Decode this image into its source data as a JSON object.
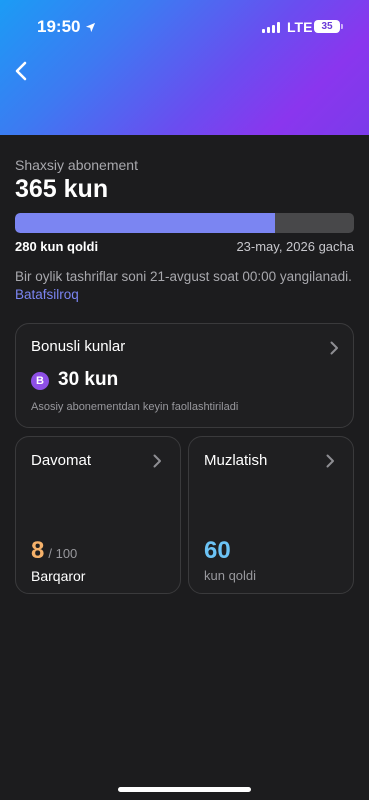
{
  "status_bar": {
    "time": "19:50",
    "network": "LTE",
    "battery": "35"
  },
  "subscription": {
    "label": "Shaxsiy abonement",
    "title": "365 kun",
    "progress_fraction": 0.767,
    "days_left": "280 kun qoldi",
    "until": "23-may, 2026 gacha",
    "info_text": "Bir oylik tashriflar soni 21-avgust soat 00:00 yangilanadi.",
    "info_link": "Batafsilroq"
  },
  "bonus_card": {
    "title": "Bonusli kunlar",
    "badge": "B",
    "value": "30 kun",
    "description": "Asosiy abonementdan keyin faollashtiriladi"
  },
  "attendance_card": {
    "title": "Davomat",
    "value": "8",
    "max": "/ 100",
    "status": "Barqaror"
  },
  "freeze_card": {
    "title": "Muzlatish",
    "value": "60",
    "subtitle": "kun qoldi"
  },
  "colors": {
    "accent": "#7b85f2",
    "attendance_value": "#f6b26b",
    "freeze_value": "#6cc3f5",
    "bonus_badge": "#8e4fe6"
  },
  "icons": {
    "back": "chevron-left-icon",
    "card_arrow": "chevron-right-icon",
    "location": "location-arrow-icon",
    "signal": "cellular-signal-icon",
    "battery": "battery-icon"
  }
}
